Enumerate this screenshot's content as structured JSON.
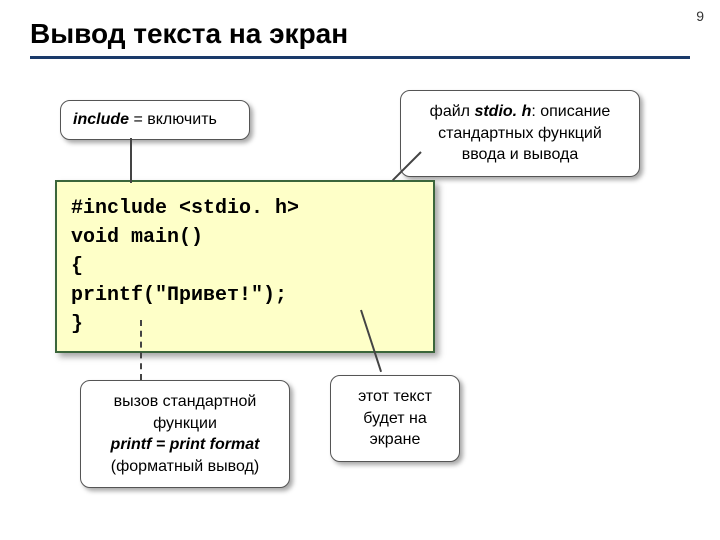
{
  "slide": {
    "number": "9",
    "title": "Вывод текста на экран"
  },
  "callouts": {
    "include_html": "<b><i>include</i></b> = включить",
    "stdio_html": "файл <b><i>stdio. h</i></b>: описание<br>стандартных функций<br>ввода и вывода",
    "printf_html": "вызов стандартной<br>функции<br><b><i>printf = print format</i></b><br>(форматный вывод)",
    "screen_html": "этот текст<br>будет на<br>экране"
  },
  "code": {
    "line1": "#include <stdio. h>",
    "line2": "void main()",
    "line3": "{",
    "line4": "printf(\"Привет!\");",
    "line5": "}"
  }
}
